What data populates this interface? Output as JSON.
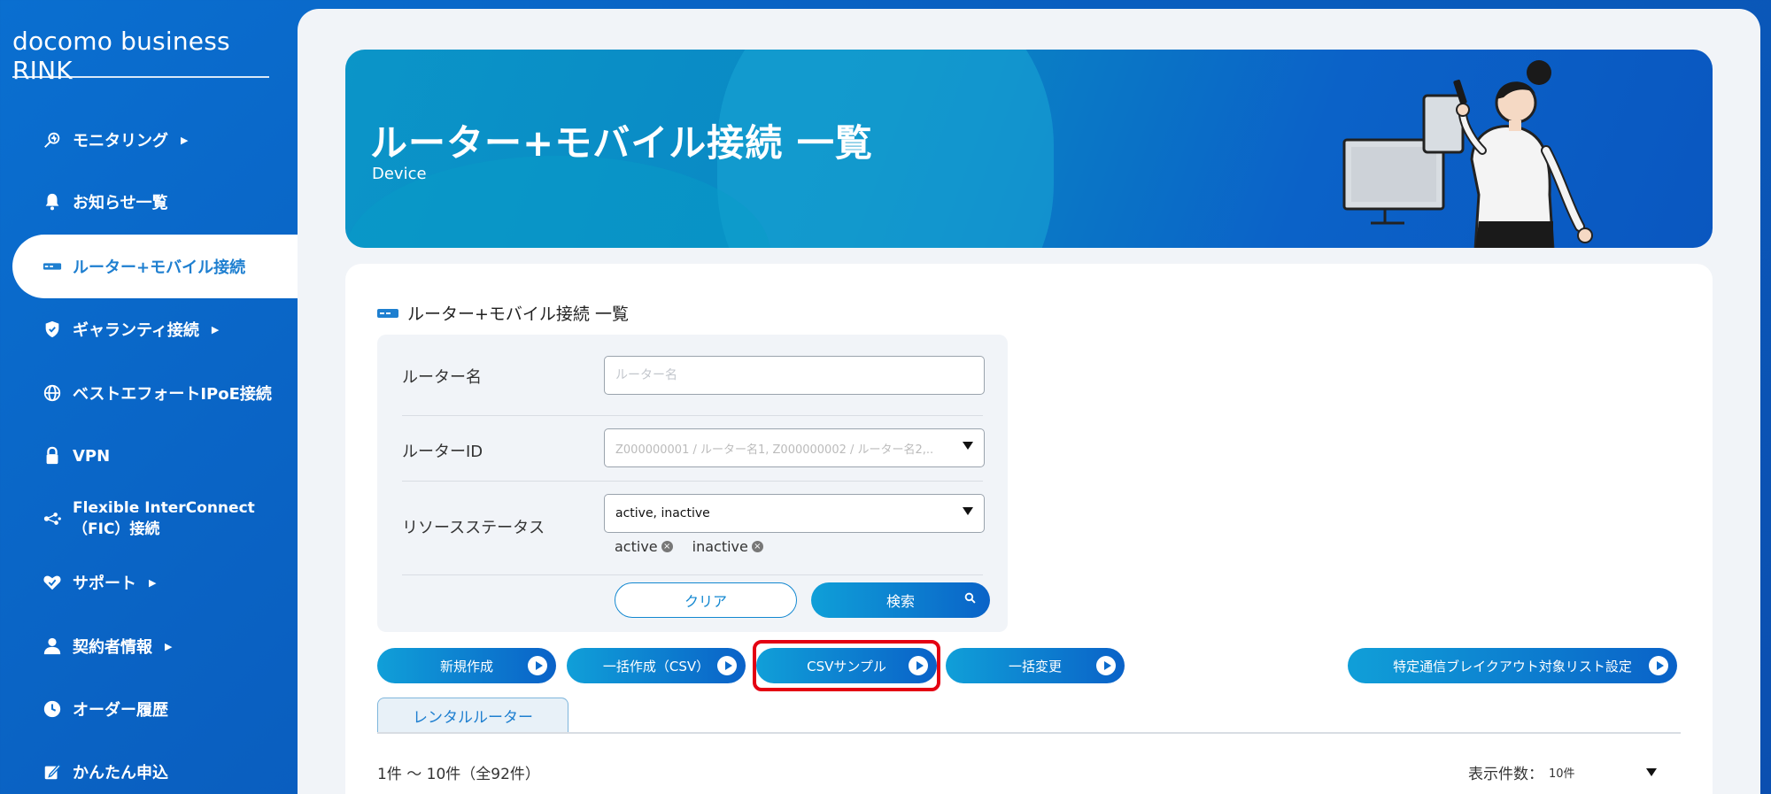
{
  "brand": "docomo business RINK",
  "sidebar": {
    "items": [
      {
        "label": "モニタリング",
        "icon": "monitoring-icon",
        "has_arrow": true
      },
      {
        "label": "お知らせ一覧",
        "icon": "bell-icon",
        "has_arrow": false
      },
      {
        "label": "ルーター+モバイル接続",
        "icon": "router-icon",
        "has_arrow": false,
        "active": true
      },
      {
        "label": "ギャランティ接続",
        "icon": "shield-icon",
        "has_arrow": true
      },
      {
        "label": "ベストエフォートIPoE接続",
        "icon": "globe-icon",
        "has_arrow": false
      },
      {
        "label": "VPN",
        "icon": "lock-icon",
        "has_arrow": false
      },
      {
        "label": "Flexible InterConnect",
        "label2": "（FIC）接続",
        "icon": "network-icon",
        "has_arrow": false
      },
      {
        "label": "サポート",
        "icon": "support-icon",
        "has_arrow": true
      },
      {
        "label": "契約者情報",
        "icon": "user-icon",
        "has_arrow": true
      },
      {
        "label": "オーダー履歴",
        "icon": "clock-icon",
        "has_arrow": false
      },
      {
        "label": "かんたん申込",
        "icon": "edit-icon",
        "has_arrow": false
      }
    ],
    "arrow_glyph": "▶"
  },
  "hero": {
    "title": "ルーター+モバイル接続 一覧",
    "subtitle": "Device"
  },
  "section_title": "ルーター+モバイル接続 一覧",
  "search": {
    "router_name_label": "ルーター名",
    "router_name_placeholder": "ルーター名",
    "router_id_label": "ルーターID",
    "router_id_placeholder": "Z000000001 / ルーター名1, Z000000002 / ルーター名2,..",
    "status_label": "リソースステータス",
    "status_value": "active, inactive",
    "chips": [
      "active",
      "inactive"
    ],
    "clear_button": "クリア",
    "search_button": "検索"
  },
  "actions": [
    {
      "label": "新規作成"
    },
    {
      "label": "一括作成（CSV）"
    },
    {
      "label": "CSVサンプル"
    },
    {
      "label": "一括変更"
    },
    {
      "label": "特定通信ブレイクアウト対象リスト設定"
    }
  ],
  "tab_label": "レンタルルーター",
  "count_text": "1件 ～ 10件（全92件）",
  "per_page_label": "表示件数：",
  "per_page_value": "10件",
  "colors": {
    "accent": "#1287d0",
    "highlight": "#e40012",
    "sidebar_bg": "#0a6fd0"
  }
}
